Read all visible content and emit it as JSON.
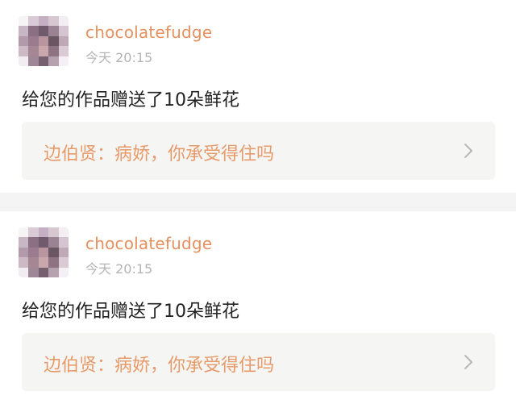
{
  "notifications": [
    {
      "username": "chocolatefudge",
      "timestamp": "今天 20:15",
      "message": "给您的作品赠送了10朵鲜花",
      "quote": "边伯贤：病娇，你承受得住吗",
      "avatar_icon": "pixelated-avatar",
      "chevron_icon": "chevron-right-icon"
    },
    {
      "username": "chocolatefudge",
      "timestamp": "今天 20:15",
      "message": "给您的作品赠送了10朵鲜花",
      "quote": "边伯贤：病娇，你承受得住吗",
      "avatar_icon": "pixelated-avatar",
      "chevron_icon": "chevron-right-icon"
    }
  ],
  "colors": {
    "username": "#e5905f",
    "quote": "#e79a6a",
    "timestamp": "#b4b4b4",
    "message": "#222222",
    "quote_background": "#f5f5f3",
    "separator": "#f4f4f4"
  }
}
